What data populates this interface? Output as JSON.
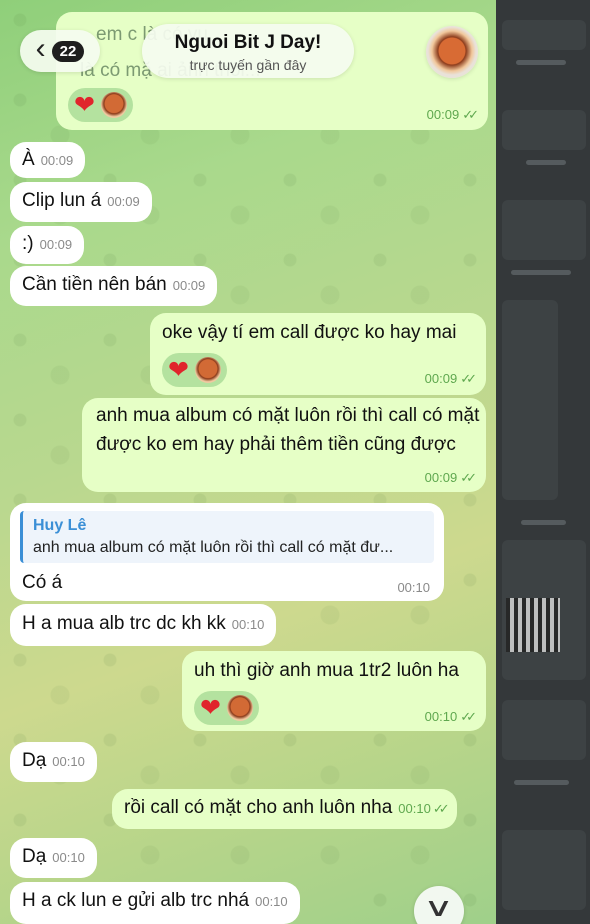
{
  "header": {
    "back_count": "22",
    "back_icon": "chevron-left-icon",
    "chat_name": "Nguoi Bit J Day!",
    "status": "trực tuyến gần đây",
    "partial_top_text": "là có mặ                  ai ảnh thôi...",
    "partial_top_text2": "em c                                 là có vu",
    "partial_top_time": "00:09"
  },
  "messages": [
    {
      "text": "À",
      "time": "00:09"
    },
    {
      "text": "Clip lun á",
      "time": "00:09"
    },
    {
      "text": ":)",
      "time": "00:09"
    },
    {
      "text": "Cần tiền nên bán",
      "time": "00:09"
    },
    {
      "text": "oke vậy tí em call được ko hay mai",
      "time": "00:09"
    },
    {
      "text": "anh mua album có mặt luôn rồi thì call có mặt được ko em hay phải thêm tiền cũng được",
      "time": "00:09"
    },
    {
      "reply_name": "Huy Lê",
      "reply_text": "anh mua album có mặt luôn rồi thì call có mặt đư...",
      "text": "Có á",
      "time": "00:10"
    },
    {
      "text": "H a mua alb trc dc kh kk",
      "time": "00:10"
    },
    {
      "text": "uh thì giờ anh mua 1tr2 luôn ha",
      "time": "00:10"
    },
    {
      "text": "Dạ",
      "time": "00:10"
    },
    {
      "text": "rồi call có mặt cho anh luôn nha",
      "time": "00:10"
    },
    {
      "text": "Dạ",
      "time": "00:10"
    },
    {
      "text": "H a ck lun e gửi alb trc nhá",
      "time": "00:10"
    }
  ],
  "reaction": {
    "heart": "❤",
    "read_check": "✓✓"
  },
  "scroll_icon": "chevron-down-icon",
  "colors": {
    "incoming": "#ffffff",
    "outgoing": "#e6ffc6",
    "time_out": "#5fa84f",
    "reply_accent": "#3b8fd6"
  }
}
